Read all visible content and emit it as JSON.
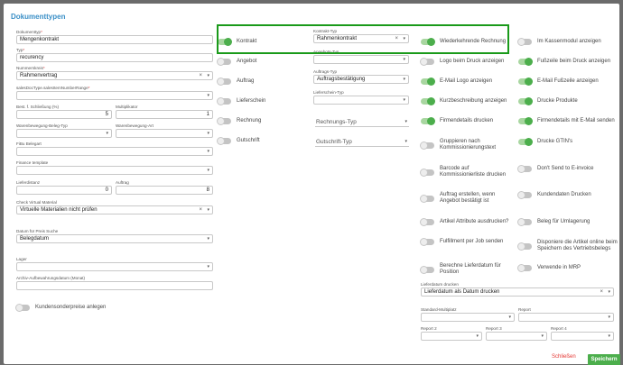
{
  "dialog": {
    "title": "Dokumenttypen"
  },
  "left": {
    "dokumenttyp": {
      "label": "Dokumenttyp",
      "value": "Mengenkontrakt"
    },
    "typ": {
      "label": "Typ",
      "value": "recurency"
    },
    "nummernkreis": {
      "label": "Nummernkreis",
      "value": "Rahmenvertrag"
    },
    "sales_doc_type": {
      "label": "salesDocType.salesItemNumberRange",
      "value": ""
    },
    "best_schliessung": {
      "label": "Best. f. Schließung (%)",
      "value": "5"
    },
    "multiplikator": {
      "label": "Multiplikator",
      "value": "1"
    },
    "warenbewegung_beleg_typ": {
      "label": "Warenbewegung-Beleg-Typ",
      "value": ""
    },
    "warenbewegung_art": {
      "label": "Warenbewegung-Art",
      "value": ""
    },
    "fibu_belegart": {
      "label": "FiBu Belegart",
      "value": ""
    },
    "finance_template": {
      "label": "Finance template",
      "value": ""
    },
    "lieferdistanz": {
      "label": "Lieferdistanz",
      "value": "0"
    },
    "auftrag": {
      "label": "Auftrag",
      "value": "8"
    },
    "check_virtual_material": {
      "label": "Check Virtual Material",
      "value": "Virtuelle Materialien nicht prüfen"
    },
    "datum_preis_suche": {
      "label": "Datum für Preis Suche",
      "value": "Belegdatum"
    },
    "lager": {
      "label": "Lager",
      "value": ""
    },
    "archiv_aufbewahrung": {
      "label": "Archiv-Aufbewahrungsdatum (Monat)",
      "value": ""
    },
    "kundensonderpreise": {
      "label": "Kundensonderpreise anlegen",
      "on": false
    }
  },
  "middle": {
    "toggles": [
      {
        "label": "Kontrakt",
        "on": true
      },
      {
        "label": "Angebot",
        "on": false
      },
      {
        "label": "Auftrag",
        "on": false
      },
      {
        "label": "Lieferschein",
        "on": false
      },
      {
        "label": "Rechnung",
        "on": false
      },
      {
        "label": "Gutschrift",
        "on": false
      }
    ],
    "kontrakt_typ": {
      "label": "Kontrakt-Typ",
      "value": "Rahmenkontrakt"
    },
    "angebots_typ": {
      "label": "Angebots-Typ",
      "value": ""
    },
    "auftrags_typ": {
      "label": "Auftrags-Typ",
      "value": "Auftragsbestätigung"
    },
    "lieferschein_typ": {
      "label": "Lieferschein-Typ",
      "value": ""
    },
    "rechnungs_typ": {
      "placeholder": "Rechnungs-Typ"
    },
    "gutschrift_typ": {
      "placeholder": "Gutschrift-Typ"
    }
  },
  "right1": {
    "toggles": [
      {
        "label": "Wiederkehrende Rechnung",
        "on": true
      },
      {
        "label": "Logo beim Druck anzeigen",
        "on": false
      },
      {
        "label": "E-Mail Logo anzeigen",
        "on": true
      },
      {
        "label": "Kurzbeschreibung anzeigen",
        "on": true
      },
      {
        "label": "Firmendetails drucken",
        "on": true
      },
      {
        "label": "Gruppieren nach Kommissionierungstext",
        "on": false
      },
      {
        "label": "Barcode auf Kommissionierliste drucken",
        "on": false
      },
      {
        "label": "Auftrag erstellen, wenn Angebot bestätigt ist",
        "on": false
      },
      {
        "label": "Artikel Attribute ausdrucken?",
        "on": false
      },
      {
        "label": "Fulfillment per Job senden",
        "on": false
      },
      {
        "label": "Berechne Lieferdatum für Position",
        "on": false
      }
    ]
  },
  "right2": {
    "toggles": [
      {
        "label": "Im Kassenmodul anzeigen",
        "on": false
      },
      {
        "label": "Fußzeile beim Druck anzeigen",
        "on": true
      },
      {
        "label": "E-Mail Fußzeile anzeigen",
        "on": true
      },
      {
        "label": "Drucke Produkte",
        "on": true
      },
      {
        "label": "Firmendetails mit E-Mail senden",
        "on": true
      },
      {
        "label": "Drucke GTIN's",
        "on": true
      },
      {
        "label": "Don't Send to E-invoice",
        "on": false
      },
      {
        "label": "Kundendaten Drucken",
        "on": false
      },
      {
        "label": "Beleg für Umlagerung",
        "on": false
      },
      {
        "label": "Disponiere die Artikel online beim Speichern des Vertriebsbelegs",
        "on": false
      },
      {
        "label": "Verwende in MRP",
        "on": false
      }
    ]
  },
  "bottom": {
    "lieferdatum": {
      "label": "Lieferdatum drucken",
      "value": "Lieferdatum als Datum drucken"
    },
    "standard_multiplatz": {
      "label": "Standard-Multiplatz",
      "value": ""
    },
    "report": {
      "label": "Report",
      "value": ""
    },
    "report2": {
      "label": "Report 2",
      "value": ""
    },
    "report3": {
      "label": "Report 3",
      "value": ""
    },
    "report4": {
      "label": "Report 4",
      "value": ""
    }
  },
  "footer": {
    "close_label": "Schließen",
    "save_label": "Speichern"
  },
  "colors": {
    "accent": "#3a8fc7",
    "toggle_on": "#4cae4c",
    "highlight": "#1a9a1a",
    "close": "#e53935"
  }
}
